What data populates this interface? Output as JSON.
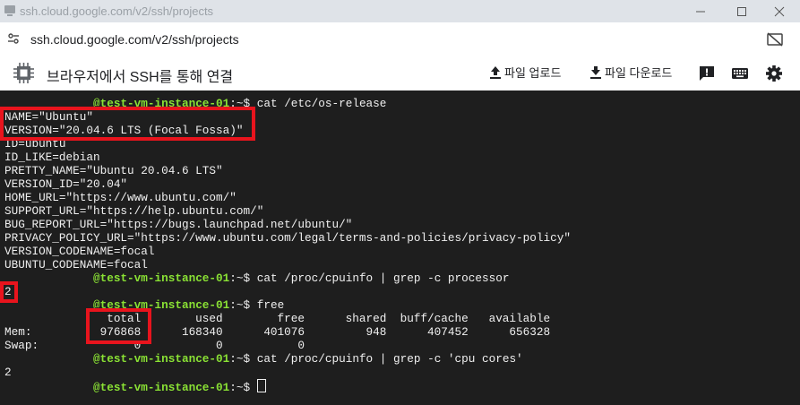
{
  "window": {
    "title": "ssh.cloud.google.com/v2/ssh/projects",
    "minimize_label": "—",
    "maximize_label": "☐",
    "close_label": "✕"
  },
  "address_bar": {
    "url": "ssh.cloud.google.com/v2/ssh/projects"
  },
  "toolbar": {
    "heading": "브라우저에서 SSH를 통해 연결",
    "upload_label": "파일 업로드",
    "download_label": "파일 다운로드",
    "icons": [
      "chip-icon",
      "upload-icon",
      "download-icon",
      "feedback-icon",
      "keyboard-icon",
      "gear-icon"
    ]
  },
  "terminal": {
    "prompt_host": "@test-vm-instance-01",
    "prompt_suffix": ":~$ ",
    "cmd1": "cat /etc/os-release",
    "os_release": [
      "NAME=\"Ubuntu\"",
      "VERSION=\"20.04.6 LTS (Focal Fossa)\"",
      "ID=ubuntu",
      "ID_LIKE=debian",
      "PRETTY_NAME=\"Ubuntu 20.04.6 LTS\"",
      "VERSION_ID=\"20.04\"",
      "HOME_URL=\"https://www.ubuntu.com/\"",
      "SUPPORT_URL=\"https://help.ubuntu.com/\"",
      "BUG_REPORT_URL=\"https://bugs.launchpad.net/ubuntu/\"",
      "PRIVACY_POLICY_URL=\"https://www.ubuntu.com/legal/terms-and-policies/privacy-policy\"",
      "VERSION_CODENAME=focal",
      "UBUNTU_CODENAME=focal"
    ],
    "cmd2": "cat /proc/cpuinfo | grep -c processor",
    "out2": "2",
    "cmd3": "free",
    "free_header": "               total        used        free      shared  buff/cache   available",
    "free_mem": "Mem:          976868      168340      401076         948      407452      656328",
    "free_swap": "Swap:              0           0           0",
    "cmd4": "cat /proc/cpuinfo | grep -c 'cpu cores'",
    "out4": "2"
  }
}
